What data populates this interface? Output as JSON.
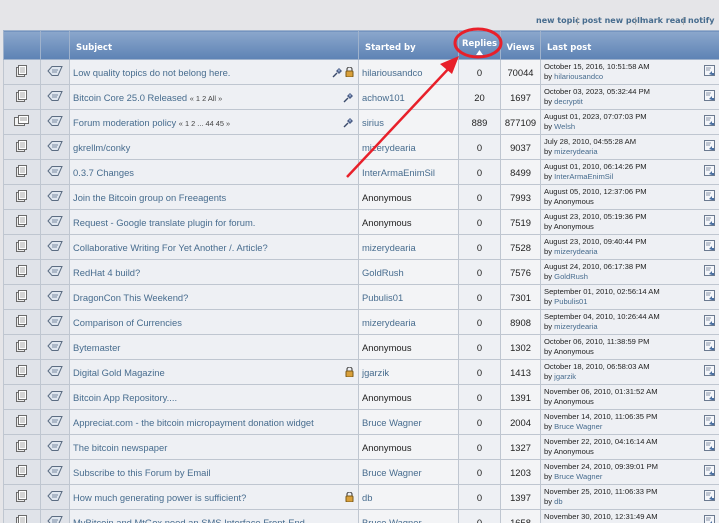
{
  "topnav": {
    "new_topic": "new topic",
    "new_poll": "post new poll",
    "mark_read": "mark read",
    "notify": "notify",
    "sep": "|"
  },
  "headers": {
    "subject": "Subject",
    "started_by": "Started by",
    "replies": "Replies",
    "views": "Views",
    "last_post": "Last post"
  },
  "by_prefix": "by",
  "topics": [
    {
      "subject": "Low quality topics do not belong here.",
      "pages": "",
      "sticky": true,
      "locked": true,
      "started_by": "hilariousandco",
      "starter_link": true,
      "replies": "0",
      "views": "70044",
      "last_date": "October 15, 2016, 10:51:58 AM",
      "last_by": "hilariousandco",
      "lp_link": true
    },
    {
      "subject": "Bitcoin Core 25.0 Released",
      "pages": "« 1 2  All »",
      "sticky": true,
      "locked": false,
      "started_by": "achow101",
      "starter_link": true,
      "replies": "20",
      "views": "1697",
      "last_date": "October 03, 2023, 05:32:44 PM",
      "last_by": "decryptit",
      "lp_link": true
    },
    {
      "subject": "Forum moderation policy",
      "pages": "« 1 2 ... 44 45 »",
      "sticky": true,
      "locked": false,
      "started_by": "sirius",
      "starter_link": true,
      "replies": "889",
      "views": "877109",
      "last_date": "August 01, 2023, 07:07:03 PM",
      "last_by": "Welsh",
      "lp_link": true
    },
    {
      "subject": "gkrellm/conky",
      "pages": "",
      "sticky": false,
      "locked": false,
      "started_by": "mizerydearia",
      "starter_link": true,
      "replies": "0",
      "views": "9037",
      "last_date": "July 28, 2010, 04:55:28 AM",
      "last_by": "mizerydearia",
      "lp_link": true
    },
    {
      "subject": "0.3.7 Changes",
      "pages": "",
      "sticky": false,
      "locked": false,
      "started_by": "InterArmaEnimSil",
      "starter_link": true,
      "replies": "0",
      "views": "8499",
      "last_date": "August 01, 2010, 06:14:26 PM",
      "last_by": "InterArmaEnimSil",
      "lp_link": true
    },
    {
      "subject": "Join the Bitcoin group on Freeagents",
      "pages": "",
      "sticky": false,
      "locked": false,
      "started_by": "Anonymous",
      "starter_link": false,
      "replies": "0",
      "views": "7993",
      "last_date": "August 05, 2010, 12:37:06 PM",
      "last_by": "Anonymous",
      "lp_link": false
    },
    {
      "subject": "Request - Google translate plugin for forum.",
      "pages": "",
      "sticky": false,
      "locked": false,
      "started_by": "Anonymous",
      "starter_link": false,
      "replies": "0",
      "views": "7519",
      "last_date": "August 23, 2010, 05:19:36 PM",
      "last_by": "Anonymous",
      "lp_link": false
    },
    {
      "subject": "Collaborative Writing For Yet Another /. Article?",
      "pages": "",
      "sticky": false,
      "locked": false,
      "started_by": "mizerydearia",
      "starter_link": true,
      "replies": "0",
      "views": "7528",
      "last_date": "August 23, 2010, 09:40:44 PM",
      "last_by": "mizerydearia",
      "lp_link": true
    },
    {
      "subject": "RedHat 4 build?",
      "pages": "",
      "sticky": false,
      "locked": false,
      "started_by": "GoldRush",
      "starter_link": true,
      "replies": "0",
      "views": "7576",
      "last_date": "August 24, 2010, 06:17:38 PM",
      "last_by": "GoldRush",
      "lp_link": true
    },
    {
      "subject": "DragonCon This Weekend?",
      "pages": "",
      "sticky": false,
      "locked": false,
      "started_by": "Pubulis01",
      "starter_link": true,
      "replies": "0",
      "views": "7301",
      "last_date": "September 01, 2010, 02:56:14 AM",
      "last_by": "Pubulis01",
      "lp_link": true
    },
    {
      "subject": "Comparison of Currencies",
      "pages": "",
      "sticky": false,
      "locked": false,
      "started_by": "mizerydearia",
      "starter_link": true,
      "replies": "0",
      "views": "8908",
      "last_date": "September 04, 2010, 10:26:44 AM",
      "last_by": "mizerydearia",
      "lp_link": true
    },
    {
      "subject": "Bytemaster",
      "pages": "",
      "sticky": false,
      "locked": false,
      "started_by": "Anonymous",
      "starter_link": false,
      "replies": "0",
      "views": "1302",
      "last_date": "October 06, 2010, 11:38:59 PM",
      "last_by": "Anonymous",
      "lp_link": false
    },
    {
      "subject": "Digital Gold Magazine",
      "pages": "",
      "sticky": false,
      "locked": true,
      "started_by": "jgarzik",
      "starter_link": true,
      "replies": "0",
      "views": "1413",
      "last_date": "October 18, 2010, 06:58:03 AM",
      "last_by": "jgarzik",
      "lp_link": true
    },
    {
      "subject": "Bitcoin App Repository....",
      "pages": "",
      "sticky": false,
      "locked": false,
      "started_by": "Anonymous",
      "starter_link": false,
      "replies": "0",
      "views": "1391",
      "last_date": "November 06, 2010, 01:31:52 AM",
      "last_by": "Anonymous",
      "lp_link": false
    },
    {
      "subject": "Appreciat.com - the bitcoin micropayment donation widget",
      "pages": "",
      "sticky": false,
      "locked": false,
      "started_by": "Bruce Wagner",
      "starter_link": true,
      "replies": "0",
      "views": "2004",
      "last_date": "November 14, 2010, 11:06:35 PM",
      "last_by": "Bruce Wagner",
      "lp_link": true
    },
    {
      "subject": "The bitcoin newspaper",
      "pages": "",
      "sticky": false,
      "locked": false,
      "started_by": "Anonymous",
      "starter_link": false,
      "replies": "0",
      "views": "1327",
      "last_date": "November 22, 2010, 04:16:14 AM",
      "last_by": "Anonymous",
      "lp_link": false
    },
    {
      "subject": "Subscribe to this Forum by Email",
      "pages": "",
      "sticky": false,
      "locked": false,
      "started_by": "Bruce Wagner",
      "starter_link": true,
      "replies": "0",
      "views": "1203",
      "last_date": "November 24, 2010, 09:39:01 PM",
      "last_by": "Bruce Wagner",
      "lp_link": true
    },
    {
      "subject": "How much generating power is sufficient?",
      "pages": "",
      "sticky": false,
      "locked": true,
      "started_by": "db",
      "starter_link": true,
      "replies": "0",
      "views": "1397",
      "last_date": "November 25, 2010, 11:06:33 PM",
      "last_by": "db",
      "lp_link": true
    },
    {
      "subject": "MyBitcoin and MtGox need an SMS Interface Front-End",
      "pages": "",
      "sticky": false,
      "locked": false,
      "started_by": "Bruce Wagner",
      "starter_link": true,
      "replies": "0",
      "views": "1658",
      "last_date": "November 30, 2010, 12:31:49 AM",
      "last_by": "Bruce Wagner",
      "lp_link": true
    }
  ],
  "colors": {
    "header_top": "#8ba7cc",
    "header_bottom": "#5d82b4",
    "link": "#476c8e",
    "annotation": "#e8202a"
  }
}
